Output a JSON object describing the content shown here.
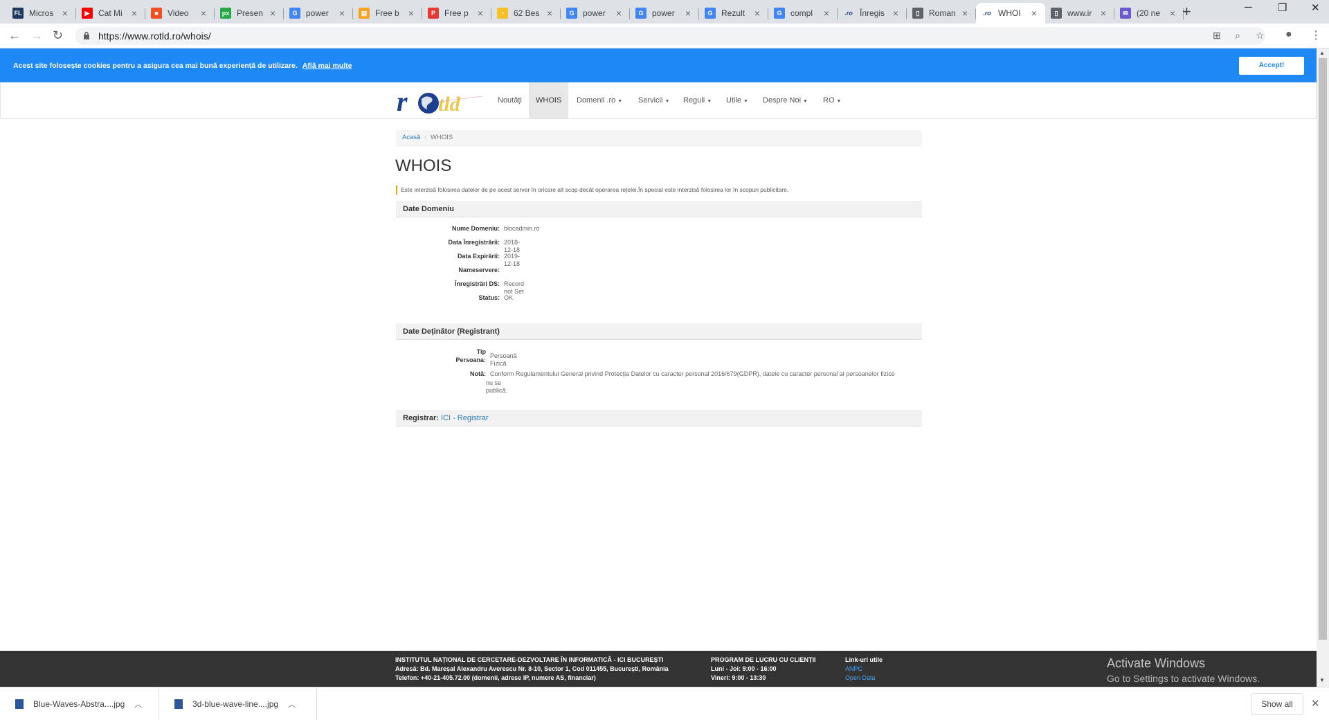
{
  "browser": {
    "tabs": [
      {
        "title": "Micros",
        "icon": "fl-icon",
        "color": "#1e3a5f",
        "glyph": "FL"
      },
      {
        "title": "Cat Mi",
        "icon": "youtube-icon",
        "color": "#ff0000",
        "glyph": "▶"
      },
      {
        "title": "Video",
        "icon": "microsoft-icon",
        "color": "#f25022",
        "glyph": "■"
      },
      {
        "title": "Presen",
        "icon": "px-icon",
        "color": "#27a745",
        "glyph": "px"
      },
      {
        "title": "power",
        "icon": "google-icon",
        "color": "#4285f4",
        "glyph": "G"
      },
      {
        "title": "Free b",
        "icon": "slides-icon",
        "color": "#f4a21f",
        "glyph": "▤"
      },
      {
        "title": "Free p",
        "icon": "p-icon",
        "color": "#e53935",
        "glyph": "P"
      },
      {
        "title": "62 Bes",
        "icon": "bell-icon",
        "color": "#f6c026",
        "glyph": "◔"
      },
      {
        "title": "power",
        "icon": "google-icon",
        "color": "#4285f4",
        "glyph": "G"
      },
      {
        "title": "power",
        "icon": "google-icon",
        "color": "#4285f4",
        "glyph": "G"
      },
      {
        "title": "Rezult",
        "icon": "google-icon",
        "color": "#4285f4",
        "glyph": "G"
      },
      {
        "title": "compl",
        "icon": "google-icon",
        "color": "#4285f4",
        "glyph": "G"
      },
      {
        "title": "Înregis",
        "icon": "ro-icon",
        "color": "#1d3f8f",
        "glyph": ".ro"
      },
      {
        "title": "Roman",
        "icon": "page-icon",
        "color": "#5f6368",
        "glyph": "▯"
      },
      {
        "title": "WHOI",
        "icon": "ro-icon",
        "color": "#1d3f8f",
        "glyph": ".ro",
        "active": true
      },
      {
        "title": "www.ir",
        "icon": "page-icon",
        "color": "#5f6368",
        "glyph": "▯"
      },
      {
        "title": "(20 ne",
        "icon": "mail-icon",
        "color": "#6a5acd",
        "glyph": "✉"
      }
    ],
    "url": "https://www.rotld.ro/whois/"
  },
  "cookie": {
    "message": "Acest site folosește cookies pentru a asigura cea mai bună experiență de utilizare.",
    "more_link": "Află mai multe",
    "accept": "Accept!"
  },
  "nav": {
    "items": [
      {
        "label": "Noutăți",
        "caret": false
      },
      {
        "label": "WHOIS",
        "caret": false,
        "active": true
      },
      {
        "label": "Domenii .ro",
        "caret": true
      },
      {
        "label": "Servicii",
        "caret": true
      },
      {
        "label": "Reguli",
        "caret": true
      },
      {
        "label": "Utile",
        "caret": true
      },
      {
        "label": "Despre Noi",
        "caret": true
      },
      {
        "label": "RO",
        "caret": true
      }
    ]
  },
  "breadcrumb": {
    "home": "Acasă",
    "current": "WHOIS"
  },
  "page": {
    "title": "WHOIS",
    "warning": "Este interzisă folosirea datelor de pe acest server în oricare alt scop decât operarea rețelei.În special este interzisă folosirea lor în scopuri publicitare."
  },
  "domain": {
    "heading": "Date Domeniu",
    "rows": [
      {
        "label": "Nume Domeniu:",
        "value": "blocadmin.ro"
      },
      {
        "label": "Data Înregistrării:",
        "value": "2018-12-18"
      },
      {
        "label": "Data Expirării:",
        "value": "2019-12-18"
      },
      {
        "label": "Nameservere:",
        "value": ""
      },
      {
        "label": "Înregistrări DS:",
        "value": "Record not Set"
      },
      {
        "label": "Status:",
        "value": "OK"
      }
    ]
  },
  "registrant": {
    "heading": "Date Deținător (Registrant)",
    "type_label_1": "Tip",
    "type_label_2": "Persoana:",
    "type_value": "Persoană Fizică",
    "note_label": "Notă:",
    "note_value_1": "Conform Regulamentului General privind Protecția Datelor cu caracter personal 2016/679(GDPR), datele cu caracter personal al persoanelor fizice",
    "note_value_2": "nu se publică."
  },
  "registrar": {
    "label": "Registrar:",
    "link": "ICI - Registrar"
  },
  "footer": {
    "org": "INSTITUTUL NAȚIONAL DE CERCETARE-DEZVOLTARE ÎN INFORMATICĂ - ICI BUCUREȘTI",
    "address_label": "Adresă:",
    "address": "Bd. Mareșal Alexandru Averescu Nr. 8-10, Sector 1, Cod 011455, București, România",
    "phone_label": "Telefon:",
    "phone": "+40-21-405.72.00 (domenii, adrese IP, numere AS, financiar)",
    "hours_title": "PROGRAM DE LUCRU CU CLIENȚII",
    "hours_1": "Luni - Joi: 9:00 - 16:00",
    "hours_2": "Vineri: 9:00 - 13:30",
    "links_title": "Link-uri utile",
    "links": [
      "ANPC",
      "Open Data"
    ]
  },
  "watermark": {
    "line1": "Activate Windows",
    "line2": "Go to Settings to activate Windows."
  },
  "downloads": {
    "items": [
      "Blue-Waves-Abstra....jpg",
      "3d-blue-wave-line....jpg"
    ],
    "show_all": "Show all"
  }
}
